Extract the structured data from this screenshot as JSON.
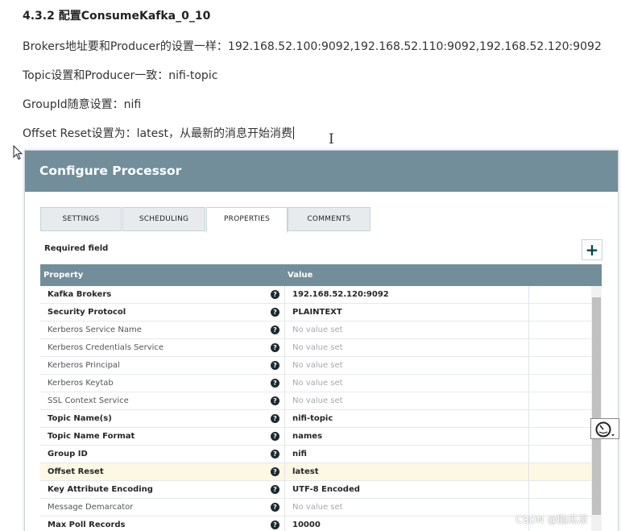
{
  "doc": {
    "heading": "4.3.2 配置ConsumeKafka_0_10",
    "lines": [
      "Brokers地址要和Producer的设置一样：192.168.52.100:9092,192.168.52.110:9092,192.168.52.120:9092",
      "Topic设置和Producer一致：nifi-topic",
      "GroupId随意设置：nifi",
      "Offset Reset设置为：latest，从最新的消息开始消费"
    ]
  },
  "dialog": {
    "title": "Configure Processor",
    "tabs": [
      {
        "label": "SETTINGS",
        "active": false
      },
      {
        "label": "SCHEDULING",
        "active": false
      },
      {
        "label": "PROPERTIES",
        "active": true
      },
      {
        "label": "COMMENTS",
        "active": false
      }
    ],
    "required_field_label": "Required field",
    "add_button_label": "+",
    "table": {
      "columns": [
        "Property",
        "Value"
      ],
      "rows": [
        {
          "name": "Kafka Brokers",
          "required": true,
          "value": "192.168.52.120:9092",
          "is_set": true
        },
        {
          "name": "Security Protocol",
          "required": true,
          "value": "PLAINTEXT",
          "is_set": true
        },
        {
          "name": "Kerberos Service Name",
          "required": false,
          "value": "No value set",
          "is_set": false
        },
        {
          "name": "Kerberos Credentials Service",
          "required": false,
          "value": "No value set",
          "is_set": false
        },
        {
          "name": "Kerberos Principal",
          "required": false,
          "value": "No value set",
          "is_set": false
        },
        {
          "name": "Kerberos Keytab",
          "required": false,
          "value": "No value set",
          "is_set": false
        },
        {
          "name": "SSL Context Service",
          "required": false,
          "value": "No value set",
          "is_set": false
        },
        {
          "name": "Topic Name(s)",
          "required": true,
          "value": "nifi-topic",
          "is_set": true
        },
        {
          "name": "Topic Name Format",
          "required": true,
          "value": "names",
          "is_set": true
        },
        {
          "name": "Group ID",
          "required": true,
          "value": "nifi",
          "is_set": true
        },
        {
          "name": "Offset Reset",
          "required": true,
          "value": "latest",
          "is_set": true,
          "highlighted": true
        },
        {
          "name": "Key Attribute Encoding",
          "required": true,
          "value": "UTF-8 Encoded",
          "is_set": true
        },
        {
          "name": "Message Demarcator",
          "required": false,
          "value": "No value set",
          "is_set": false
        },
        {
          "name": "Max Poll Records",
          "required": true,
          "value": "10000",
          "is_set": true
        }
      ]
    },
    "help_icon_glyph": "?"
  },
  "watermark": "CSDN @脑瓜凉",
  "icons": {
    "cursor_arrow": "arrow-cursor-icon",
    "text_cursor": "ibeam-cursor-icon",
    "help": "help-circle-icon",
    "add": "plus-icon",
    "side_widget": "speed-gauge-icon"
  },
  "colors": {
    "header": "#728e9b",
    "help_icon": "#1b2a31",
    "highlight_row": "#fdf8e4",
    "empty_value": "#a5a9ab"
  }
}
